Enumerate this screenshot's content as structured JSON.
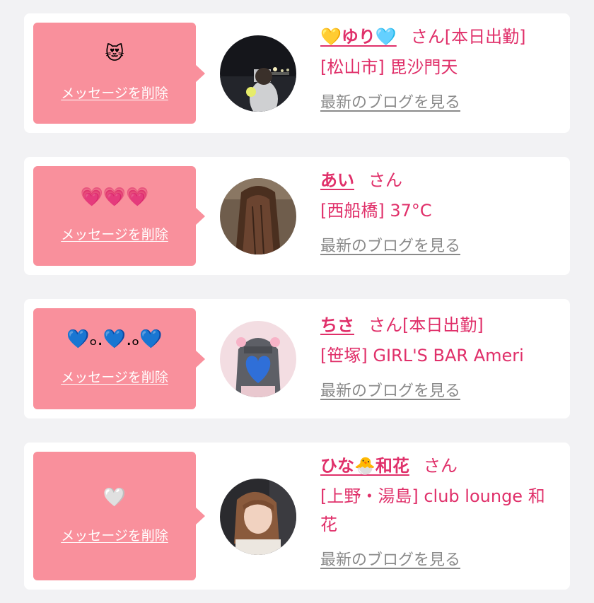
{
  "items": [
    {
      "stamp": "😻",
      "delete_label": "メッセージを削除",
      "name": "💛ゆり🩵",
      "honorific": "さん",
      "status": "[本日出勤]",
      "shop": "[松山市] 毘沙門天",
      "blog_label": "最新のブログを見る",
      "avatar": "night-photo-avatar"
    },
    {
      "stamp": "💗💗💗",
      "delete_label": "メッセージを削除",
      "name": "あい",
      "honorific": "さん",
      "status": "",
      "shop": "[西船橋] 37°C",
      "blog_label": "最新のブログを見る",
      "avatar": "long-hair-avatar"
    },
    {
      "stamp": "💙ₒ.💙.ₒ💙",
      "delete_label": "メッセージを削除",
      "name": "ちさ",
      "honorific": "さん",
      "status": "[本日出勤]",
      "shop": "[笹塚] GIRL'S BAR Ameri",
      "blog_label": "最新のブログを見る",
      "avatar": "heart-face-avatar"
    },
    {
      "stamp": "🤍",
      "delete_label": "メッセージを削除",
      "name": "ひな🐣和花",
      "honorific": "さん",
      "status": "",
      "shop": "[上野・湯島] club lounge 和花",
      "blog_label": "最新のブログを見る",
      "avatar": "portrait-avatar"
    }
  ],
  "colors": {
    "accent": "#e0306a",
    "bubble": "#f9909c",
    "background": "#f2f2f4",
    "link_gray": "#8a8a8a"
  }
}
